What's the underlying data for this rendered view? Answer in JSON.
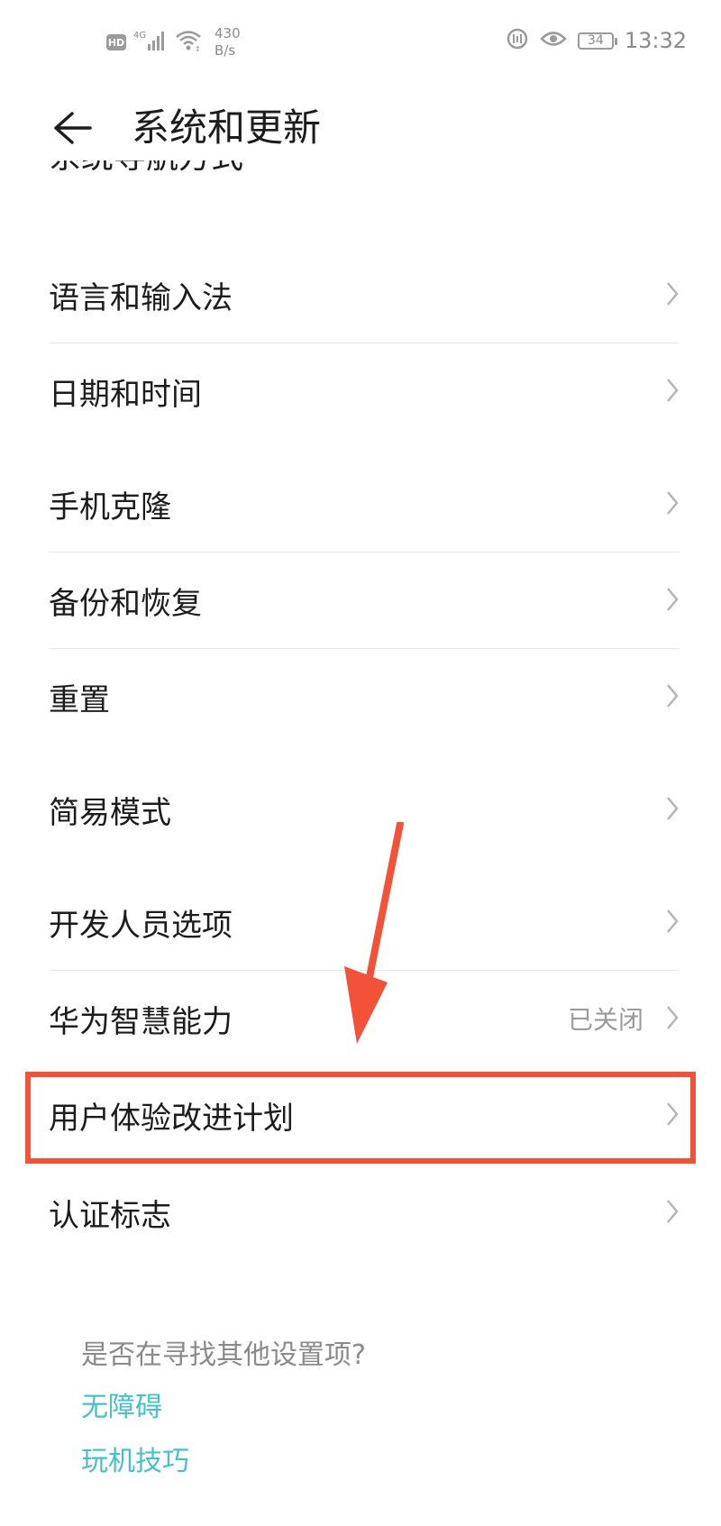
{
  "status_bar": {
    "hd_label": "HD",
    "network_type": "4G",
    "speed_value": "430",
    "speed_unit": "B/s",
    "battery_level": "34",
    "time": "13:32",
    "icons": [
      "hd-icon",
      "signal-icon",
      "wifi-icon",
      "nfc-icon",
      "eye-comfort-icon",
      "battery-icon"
    ]
  },
  "header": {
    "back_icon": "back-arrow-icon",
    "title": "系统和更新"
  },
  "cut_item": {
    "label": "系统导航方式"
  },
  "items": [
    {
      "id": "language-input",
      "label": "语言和输入法",
      "value": ""
    },
    {
      "id": "date-time",
      "label": "日期和时间",
      "value": ""
    },
    {
      "id": "phone-clone",
      "label": "手机克隆",
      "value": ""
    },
    {
      "id": "backup-restore",
      "label": "备份和恢复",
      "value": ""
    },
    {
      "id": "reset",
      "label": "重置",
      "value": ""
    },
    {
      "id": "simple-mode",
      "label": "简易模式",
      "value": ""
    },
    {
      "id": "developer-options",
      "label": "开发人员选项",
      "value": ""
    },
    {
      "id": "huawei-ai",
      "label": "华为智慧能力",
      "value": "已关闭"
    },
    {
      "id": "ux-improvement",
      "label": "用户体验改进计划",
      "value": ""
    },
    {
      "id": "certification",
      "label": "认证标志",
      "value": ""
    }
  ],
  "footer": {
    "question": "是否在寻找其他设置项?",
    "links": [
      "无障碍",
      "玩机技巧"
    ]
  },
  "colors": {
    "highlight": "#f45238",
    "link": "#47c1c7",
    "secondary_text": "#9b9b9b"
  }
}
